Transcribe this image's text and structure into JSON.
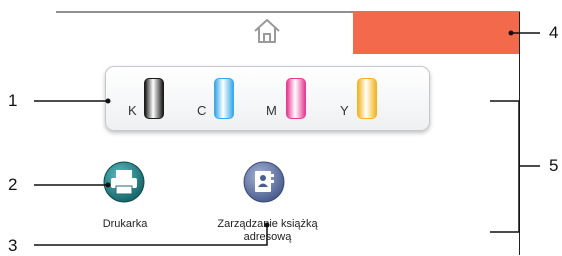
{
  "screen": {
    "home_icon": "home-icon",
    "notification_bar_color": "#F26A4B"
  },
  "ink_panel": {
    "cartridges": [
      {
        "letter": "K",
        "color": "#1A1A1A"
      },
      {
        "letter": "C",
        "color": "#39A9E8"
      },
      {
        "letter": "M",
        "color": "#E63C96"
      },
      {
        "letter": "Y",
        "color": "#F5B51E"
      }
    ]
  },
  "apps": [
    {
      "label": "Drukarka",
      "icon": "printer-icon",
      "color": "#1E7E82"
    },
    {
      "label_line1": "Zarządzanie książką",
      "label_line2": "adresową",
      "icon": "address-book-icon",
      "color": "#5B6E9E"
    }
  ],
  "callouts": [
    "1",
    "2",
    "3",
    "4",
    "5"
  ]
}
